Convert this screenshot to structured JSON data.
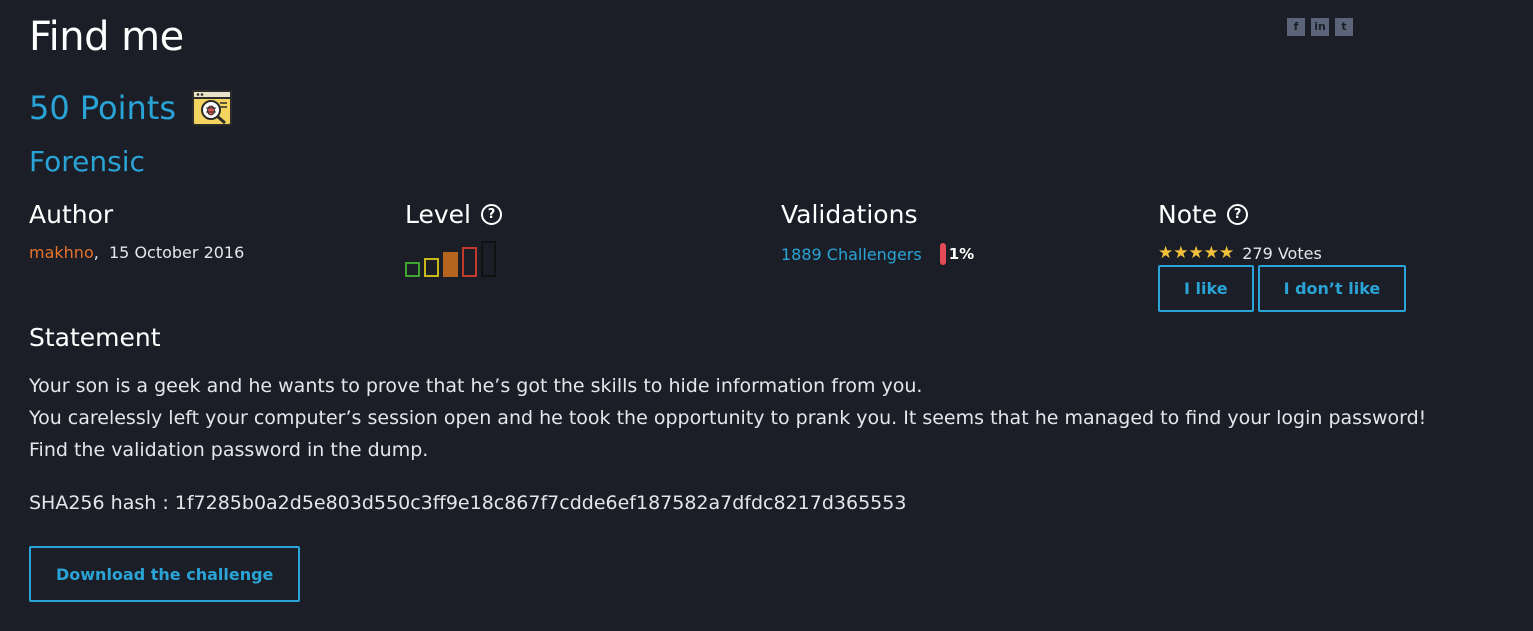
{
  "challenge": {
    "title": "Find me",
    "points": "50 Points",
    "category_icon": "bug-magnifier-icon",
    "category": "Forensic"
  },
  "social": {
    "facebook": "f",
    "linkedin": "in",
    "twitter": "t"
  },
  "author": {
    "heading": "Author",
    "name": "makhno",
    "separator": ",",
    "date": "15 October 2016"
  },
  "level": {
    "heading": "Level",
    "colors": [
      "#3ea62e",
      "#c8b81a",
      "#b5651d",
      "#c0392b",
      "#111111"
    ],
    "current": 3
  },
  "validations": {
    "heading": "Validations",
    "challengers": "1889 Challengers",
    "percent": "1%",
    "bar_color": "#e34c56"
  },
  "note": {
    "heading": "Note",
    "stars": "★★★★★",
    "votes": "279 Votes",
    "like_label": "I like",
    "dislike_label": "I don’t like"
  },
  "statement": {
    "heading": "Statement",
    "line1": "Your son is a geek and he wants to prove that he’s got the skills to hide information from you.",
    "line2": "You carelessly left your computer’s session open and he took the opportunity to prank you. It seems that he managed to find your login password!",
    "line3": "Find the validation password in the dump.",
    "hash": "SHA256 hash : 1f7285b0a2d5e803d550c3ff9e18c867f7cdde6ef187582a7dfdc8217d365553"
  },
  "actions": {
    "download_label": "Download the challenge"
  },
  "colors": {
    "accent": "#2aa3d6",
    "background": "#1b1e26",
    "author_link": "#e8732b",
    "stars": "#f2c13c"
  }
}
